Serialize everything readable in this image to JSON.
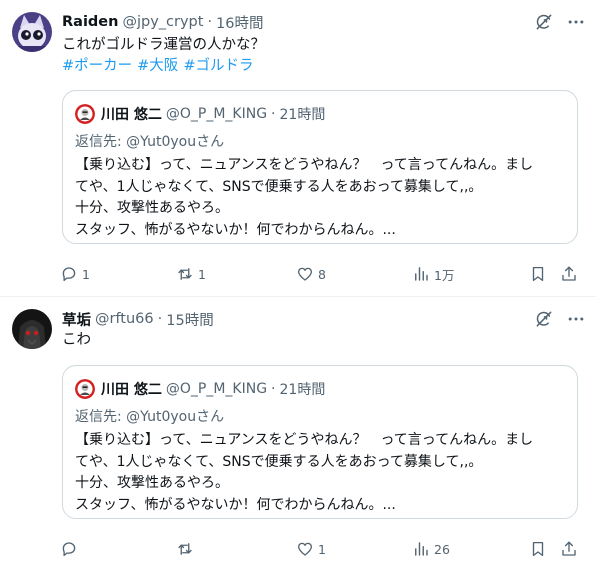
{
  "tweets": [
    {
      "author": {
        "name": "Raiden",
        "handle": "@jpy_crypt",
        "time": "16時間"
      },
      "text": "これがゴルドラ運営の人かな？",
      "hashtags": [
        "#ポーカー",
        "#大阪",
        "#ゴルドラ"
      ],
      "quote": {
        "author": {
          "name": "川田 悠二",
          "handle": "@O_P_M_KING",
          "time": "21時間"
        },
        "reply_label": "返信先:",
        "reply_to": "@Yut0youさん",
        "lines": [
          "【乗り込む】って、ニュアンスをどうやねん？　って言ってんねん。まし",
          "てや、1人じゃなくて、SNSで便乗する人をあおって募集して,,。",
          "十分、攻撃性あるやろ。",
          "スタッフ、怖がるやないか！何でわからんねん。..."
        ]
      },
      "actions": {
        "replies": "1",
        "retweets": "1",
        "likes": "8",
        "views": "1万"
      }
    },
    {
      "author": {
        "name": "草垢",
        "handle": "@rftu66",
        "time": "15時間"
      },
      "text": "こわ",
      "quote": {
        "author": {
          "name": "川田 悠二",
          "handle": "@O_P_M_KING",
          "time": "21時間"
        },
        "reply_label": "返信先:",
        "reply_to": "@Yut0youさん",
        "lines": [
          "【乗り込む】って、ニュアンスをどうやねん？　って言ってんねん。まし",
          "てや、1人じゃなくて、SNSで便乗する人をあおって募集して,,。",
          "十分、攻撃性あるやろ。",
          "スタッフ、怖がるやないか！何でわからんねん。..."
        ]
      },
      "actions": {
        "replies": "",
        "retweets": "",
        "likes": "1",
        "views": "26"
      }
    }
  ],
  "icons": {
    "grok": "grok-icon",
    "more": "more-icon",
    "reply": "reply-icon",
    "retweet": "retweet-icon",
    "like": "heart-icon",
    "views": "views-icon",
    "bookmark": "bookmark-icon",
    "share": "share-icon"
  },
  "colors": {
    "hashtag": "#1d9bf0",
    "secondary_text": "#536471",
    "border": "#cfd9de"
  }
}
